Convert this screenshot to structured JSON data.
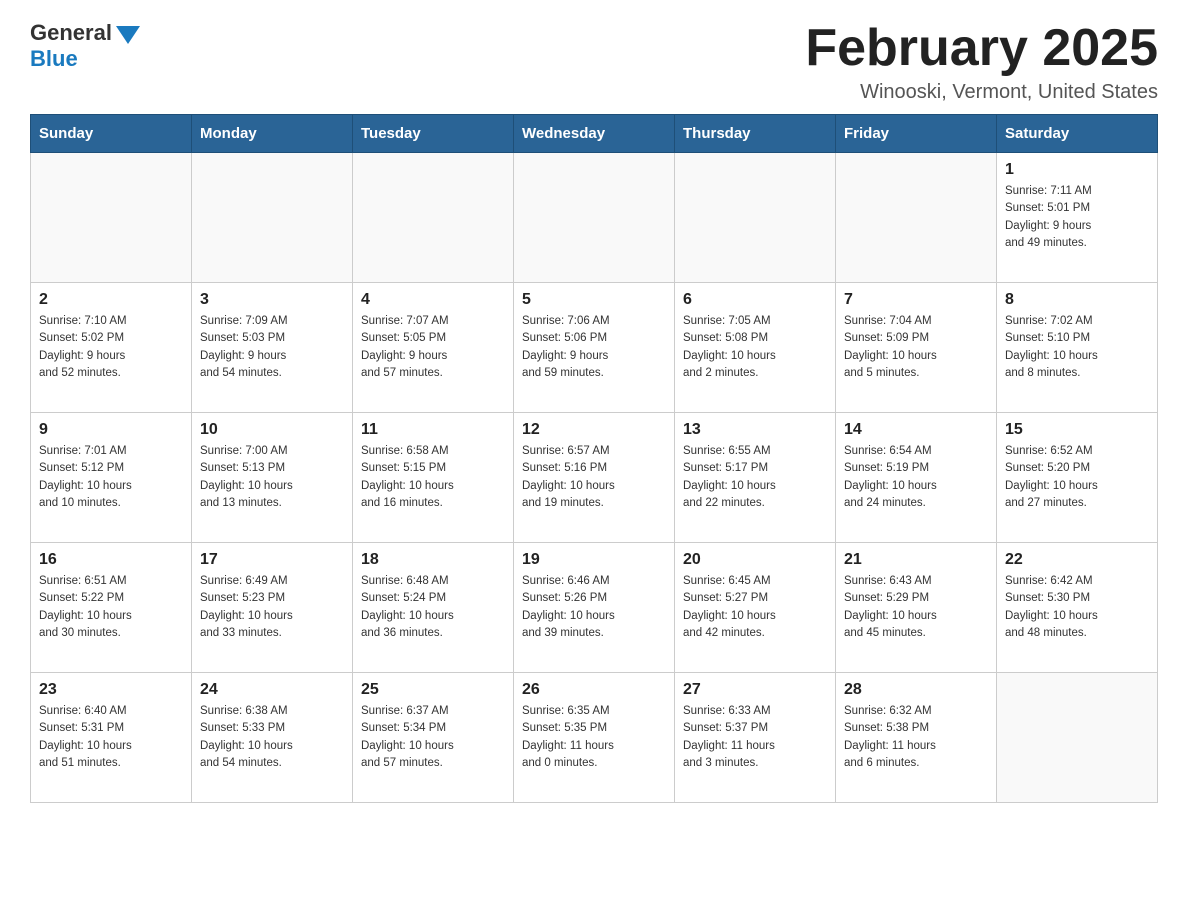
{
  "logo": {
    "general": "General",
    "blue": "Blue"
  },
  "title": {
    "month_year": "February 2025",
    "location": "Winooski, Vermont, United States"
  },
  "weekdays": [
    "Sunday",
    "Monday",
    "Tuesday",
    "Wednesday",
    "Thursday",
    "Friday",
    "Saturday"
  ],
  "weeks": [
    [
      {
        "day": "",
        "info": ""
      },
      {
        "day": "",
        "info": ""
      },
      {
        "day": "",
        "info": ""
      },
      {
        "day": "",
        "info": ""
      },
      {
        "day": "",
        "info": ""
      },
      {
        "day": "",
        "info": ""
      },
      {
        "day": "1",
        "info": "Sunrise: 7:11 AM\nSunset: 5:01 PM\nDaylight: 9 hours\nand 49 minutes."
      }
    ],
    [
      {
        "day": "2",
        "info": "Sunrise: 7:10 AM\nSunset: 5:02 PM\nDaylight: 9 hours\nand 52 minutes."
      },
      {
        "day": "3",
        "info": "Sunrise: 7:09 AM\nSunset: 5:03 PM\nDaylight: 9 hours\nand 54 minutes."
      },
      {
        "day": "4",
        "info": "Sunrise: 7:07 AM\nSunset: 5:05 PM\nDaylight: 9 hours\nand 57 minutes."
      },
      {
        "day": "5",
        "info": "Sunrise: 7:06 AM\nSunset: 5:06 PM\nDaylight: 9 hours\nand 59 minutes."
      },
      {
        "day": "6",
        "info": "Sunrise: 7:05 AM\nSunset: 5:08 PM\nDaylight: 10 hours\nand 2 minutes."
      },
      {
        "day": "7",
        "info": "Sunrise: 7:04 AM\nSunset: 5:09 PM\nDaylight: 10 hours\nand 5 minutes."
      },
      {
        "day": "8",
        "info": "Sunrise: 7:02 AM\nSunset: 5:10 PM\nDaylight: 10 hours\nand 8 minutes."
      }
    ],
    [
      {
        "day": "9",
        "info": "Sunrise: 7:01 AM\nSunset: 5:12 PM\nDaylight: 10 hours\nand 10 minutes."
      },
      {
        "day": "10",
        "info": "Sunrise: 7:00 AM\nSunset: 5:13 PM\nDaylight: 10 hours\nand 13 minutes."
      },
      {
        "day": "11",
        "info": "Sunrise: 6:58 AM\nSunset: 5:15 PM\nDaylight: 10 hours\nand 16 minutes."
      },
      {
        "day": "12",
        "info": "Sunrise: 6:57 AM\nSunset: 5:16 PM\nDaylight: 10 hours\nand 19 minutes."
      },
      {
        "day": "13",
        "info": "Sunrise: 6:55 AM\nSunset: 5:17 PM\nDaylight: 10 hours\nand 22 minutes."
      },
      {
        "day": "14",
        "info": "Sunrise: 6:54 AM\nSunset: 5:19 PM\nDaylight: 10 hours\nand 24 minutes."
      },
      {
        "day": "15",
        "info": "Sunrise: 6:52 AM\nSunset: 5:20 PM\nDaylight: 10 hours\nand 27 minutes."
      }
    ],
    [
      {
        "day": "16",
        "info": "Sunrise: 6:51 AM\nSunset: 5:22 PM\nDaylight: 10 hours\nand 30 minutes."
      },
      {
        "day": "17",
        "info": "Sunrise: 6:49 AM\nSunset: 5:23 PM\nDaylight: 10 hours\nand 33 minutes."
      },
      {
        "day": "18",
        "info": "Sunrise: 6:48 AM\nSunset: 5:24 PM\nDaylight: 10 hours\nand 36 minutes."
      },
      {
        "day": "19",
        "info": "Sunrise: 6:46 AM\nSunset: 5:26 PM\nDaylight: 10 hours\nand 39 minutes."
      },
      {
        "day": "20",
        "info": "Sunrise: 6:45 AM\nSunset: 5:27 PM\nDaylight: 10 hours\nand 42 minutes."
      },
      {
        "day": "21",
        "info": "Sunrise: 6:43 AM\nSunset: 5:29 PM\nDaylight: 10 hours\nand 45 minutes."
      },
      {
        "day": "22",
        "info": "Sunrise: 6:42 AM\nSunset: 5:30 PM\nDaylight: 10 hours\nand 48 minutes."
      }
    ],
    [
      {
        "day": "23",
        "info": "Sunrise: 6:40 AM\nSunset: 5:31 PM\nDaylight: 10 hours\nand 51 minutes."
      },
      {
        "day": "24",
        "info": "Sunrise: 6:38 AM\nSunset: 5:33 PM\nDaylight: 10 hours\nand 54 minutes."
      },
      {
        "day": "25",
        "info": "Sunrise: 6:37 AM\nSunset: 5:34 PM\nDaylight: 10 hours\nand 57 minutes."
      },
      {
        "day": "26",
        "info": "Sunrise: 6:35 AM\nSunset: 5:35 PM\nDaylight: 11 hours\nand 0 minutes."
      },
      {
        "day": "27",
        "info": "Sunrise: 6:33 AM\nSunset: 5:37 PM\nDaylight: 11 hours\nand 3 minutes."
      },
      {
        "day": "28",
        "info": "Sunrise: 6:32 AM\nSunset: 5:38 PM\nDaylight: 11 hours\nand 6 minutes."
      },
      {
        "day": "",
        "info": ""
      }
    ]
  ]
}
